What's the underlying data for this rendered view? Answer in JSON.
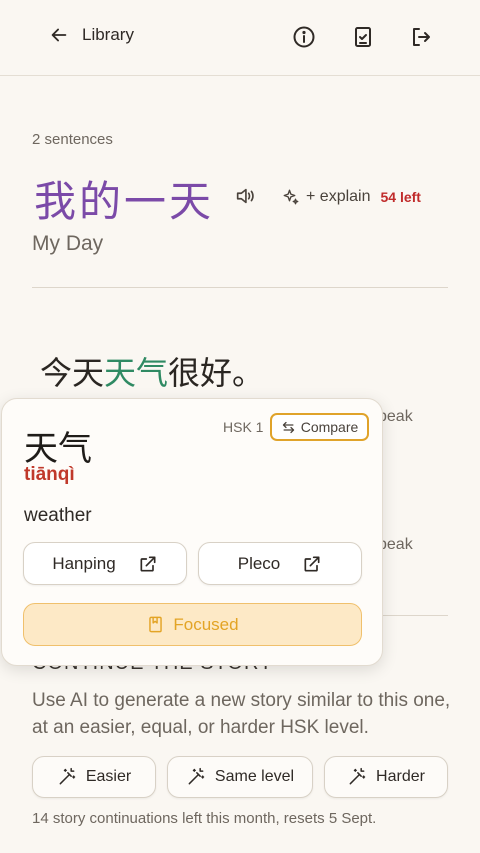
{
  "topbar": {
    "back_label": "Library",
    "icons": [
      "arrow-left-icon",
      "info-icon",
      "clipboard-check-icon",
      "logout-icon"
    ]
  },
  "story": {
    "sentence_count": "2 sentences",
    "title_cn": "我的一天",
    "title_en": "My Day",
    "explain_label": "+ explain",
    "explain_left": "54 left"
  },
  "sentence": {
    "before": "今天",
    "highlight": "天气",
    "after": "很好。"
  },
  "behind_card": {
    "peek_1": "peak",
    "peek_2": "peak"
  },
  "popup": {
    "hanzi": "天气",
    "pinyin": "tiānqì",
    "hsk": "HSK 1",
    "compare_label": "Compare",
    "meaning": "weather",
    "hanping_label": "Hanping",
    "pleco_label": "Pleco",
    "focused_label": "Focused"
  },
  "continue": {
    "heading": "CONTINUE THE STORY",
    "description": "Use AI to generate a new story similar to this one, at an easier, equal, or harder HSK level.",
    "buttons": [
      "Easier",
      "Same level",
      "Harder"
    ],
    "footnote": "14 story continuations left this month, resets 5 Sept."
  },
  "colors": {
    "title_purple": "#7b4aa8",
    "highlight_green": "#2f8a63",
    "pinyin_red": "#c0392b",
    "compare_border": "#e0a32a",
    "focused_bg": "#fde9c6"
  }
}
